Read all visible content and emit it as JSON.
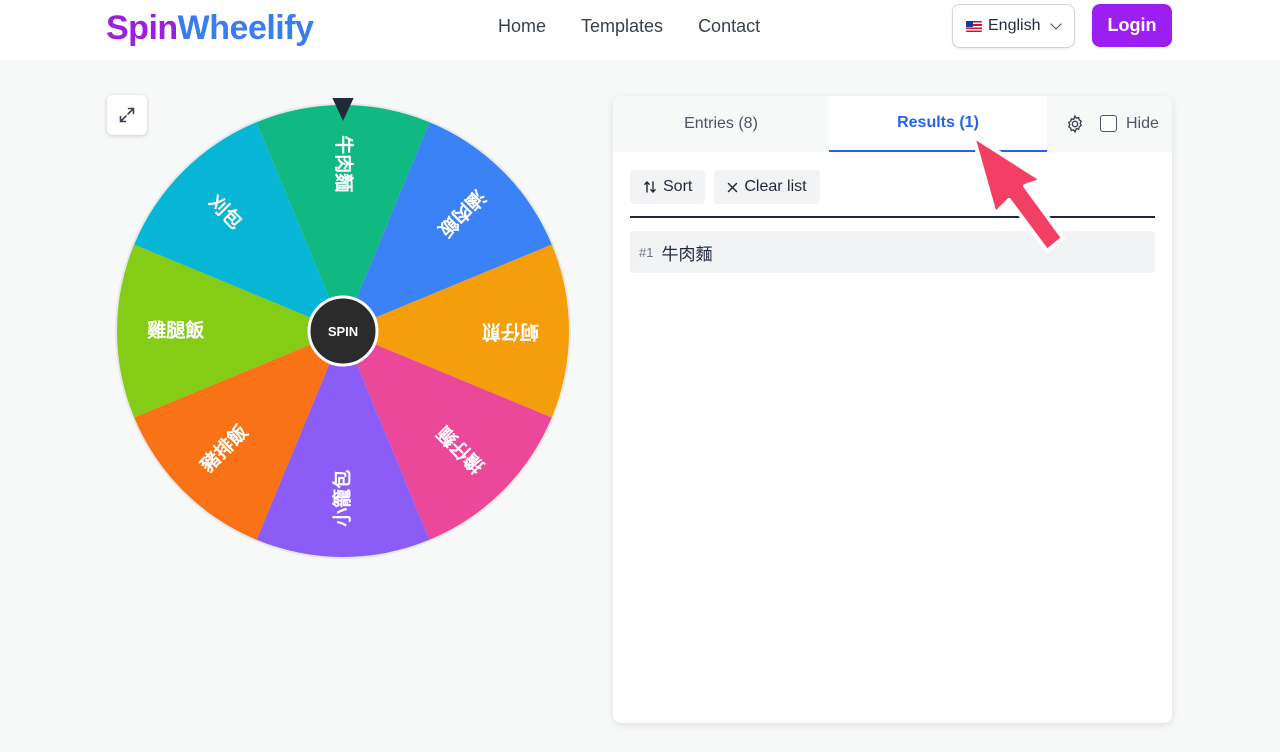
{
  "header": {
    "logo_part1": "Spin",
    "logo_part2": "Wheelify",
    "nav": [
      "Home",
      "Templates",
      "Contact"
    ],
    "language": "English",
    "login_label": "Login"
  },
  "wheel": {
    "center_label": "SPIN",
    "segments": [
      {
        "label": "牛肉麵",
        "color": "#10b981"
      },
      {
        "label": "滷肉飯",
        "color": "#3b82f6"
      },
      {
        "label": "蚵仔煎",
        "color": "#f59e0b"
      },
      {
        "label": "擔仔麵",
        "color": "#ec4899"
      },
      {
        "label": "小籠包",
        "color": "#8b5cf6"
      },
      {
        "label": "豬排飯",
        "color": "#f97316"
      },
      {
        "label": "雞腿飯",
        "color": "#84cc16"
      },
      {
        "label": "刈包",
        "color": "#06b6d4"
      }
    ]
  },
  "panel": {
    "tabs": {
      "entries": "Entries (8)",
      "results": "Results (1)"
    },
    "hide_label": "Hide",
    "sort_label": "Sort",
    "clear_label": "Clear list",
    "results": [
      {
        "num": "#1",
        "text": "牛肉麵"
      }
    ]
  },
  "colors": {
    "brand_purple": "#9b1ff0",
    "brand_blue": "#3a7df0",
    "accent": "#2563eb",
    "annotation_arrow": "#f43f64"
  }
}
